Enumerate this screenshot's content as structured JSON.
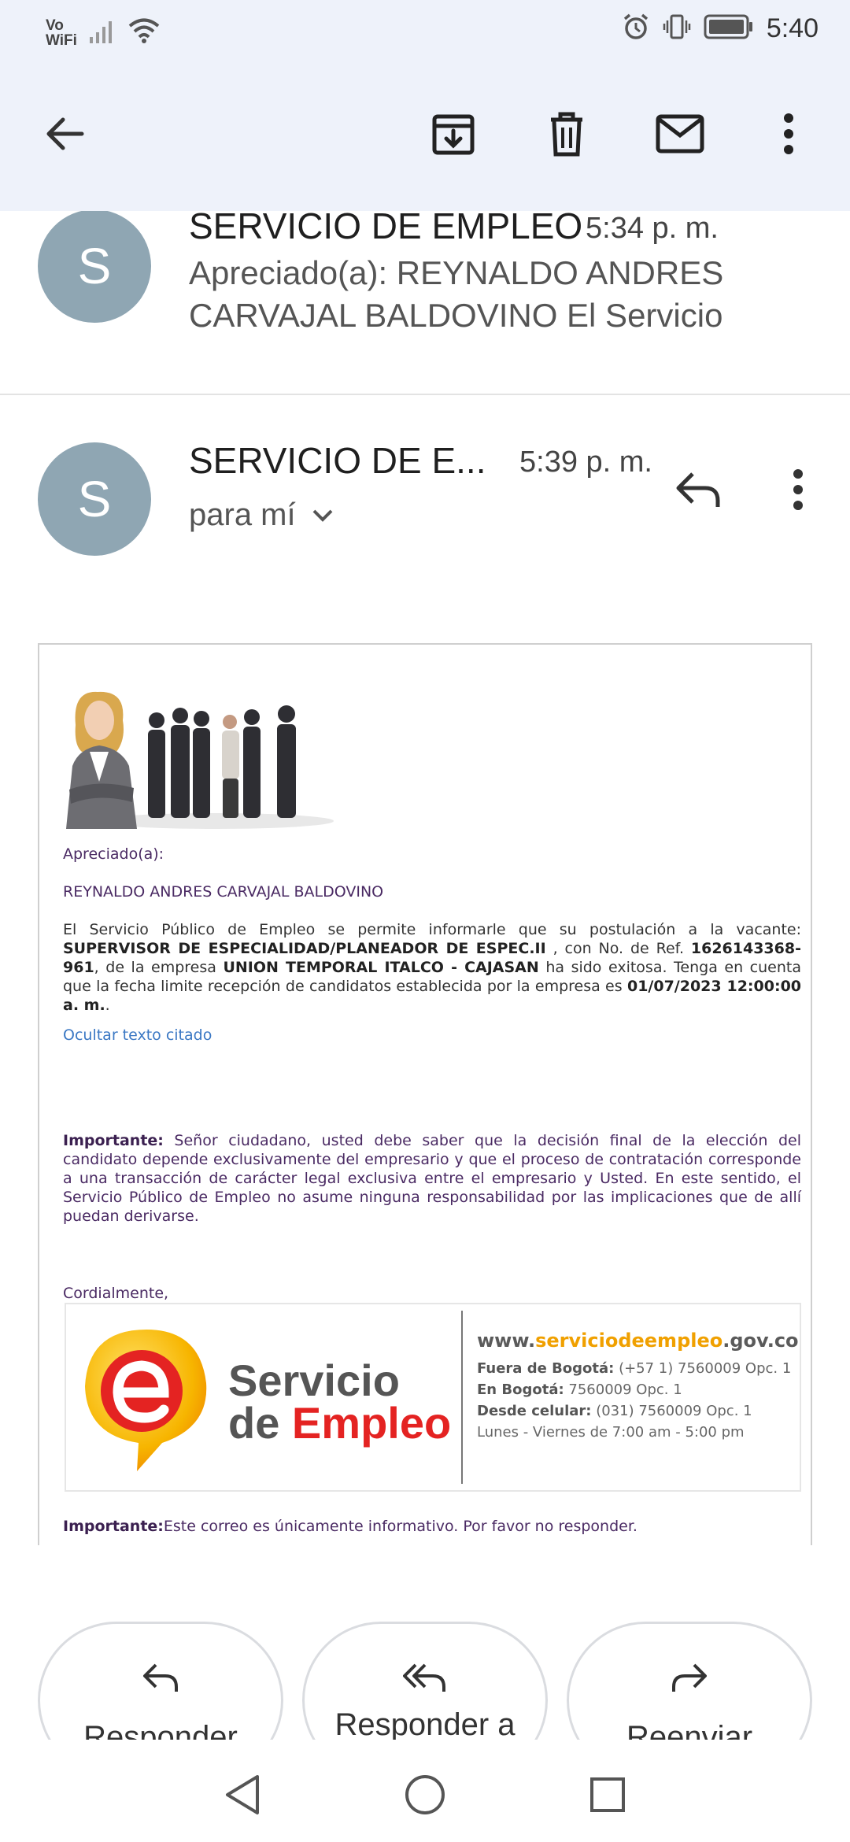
{
  "status_bar": {
    "network_label": "Vo\nWiFi",
    "time": "5:40",
    "icons": [
      "signal-icon",
      "wifi-icon",
      "alarm-icon",
      "vibrate-icon",
      "battery-icon"
    ]
  },
  "app_bar": {
    "icons": [
      "back-arrow-icon",
      "archive-icon",
      "delete-icon",
      "mail-icon",
      "more-vert-icon"
    ]
  },
  "thread": {
    "collapsed_message": {
      "avatar_letter": "S",
      "sender": "SERVICIO DE EMPLEO",
      "time": "5:34 p. m.",
      "snippet": "Apreciado(a): REYNALDO ANDRES CARVAJAL BALDOVINO El Servicio"
    },
    "expanded_message": {
      "avatar_letter": "S",
      "sender": "SERVICIO DE E...",
      "time": "5:39 p. m.",
      "recipient": "para mí",
      "icons": [
        "reply-icon",
        "more-vert-icon"
      ]
    }
  },
  "email": {
    "greeting": "Apreciado(a):",
    "name": "REYNALDO ANDRES CARVAJAL BALDOVINO",
    "body": {
      "intro": "El Servicio Público de Empleo se permite informarle que su postulación a la vacante: ",
      "vacancy": "SUPERVISOR DE ESPECIALIDAD/PLANEADOR DE ESPEC.II",
      "ref_text": " , con No. de Ref. ",
      "ref_number": "1626143368-961",
      "company_text": ", de la empresa ",
      "company": "UNION TEMPORAL ITALCO - CAJASAN",
      "success_text": " ha sido exitosa. Tenga en cuenta que la fecha limite recepción de candidatos establecida por la empresa es ",
      "deadline": "01/07/2023 12:00:00 a. m.",
      "end": "."
    },
    "hide_quoted": "Ocultar texto citado",
    "important": {
      "label": "Importante:",
      "text": " Señor ciudadano, usted debe saber que la decisión final de la elección del candidato depende exclusivamente del empresario y que el proceso de contratación corresponde a una transacción de carácter legal exclusiva entre el empresario y Usted. En este sentido, el Servicio Público de Empleo no asume ninguna responsabilidad por las implicaciones que de allí puedan derivarse."
    },
    "closing": "Cordialmente,",
    "banner": {
      "brand_line1": "Servicio",
      "brand_line2_a": "de ",
      "brand_line2_b": "Empleo",
      "url_a": "www.",
      "url_b": "serviciodeempleo",
      "url_c": ".gov.co",
      "line1_label": "Fuera de Bogotá:",
      "line1_value": " (+57 1) 7560009 Opc. 1",
      "line2_label": "En Bogotá:",
      "line2_value": " 7560009 Opc. 1",
      "line3_label": "Desde celular:",
      "line3_value": " (031) 7560009 Opc. 1",
      "line4": "Lunes - Viernes de 7:00 am - 5:00 pm"
    },
    "footer": {
      "label": "Importante:",
      "text": "Este correo es únicamente informativo. Por favor no responder."
    }
  },
  "actions": {
    "reply": "Responder",
    "reply_all": "Responder a",
    "forward": "Reenviar"
  },
  "colors": {
    "top_bar_bg": "#eef2fa",
    "avatar_bg": "#8fa6b3",
    "email_text": "#4a2a63",
    "link": "#3b78c4",
    "brand_red": "#e42322",
    "brand_orange": "#f0a000"
  }
}
